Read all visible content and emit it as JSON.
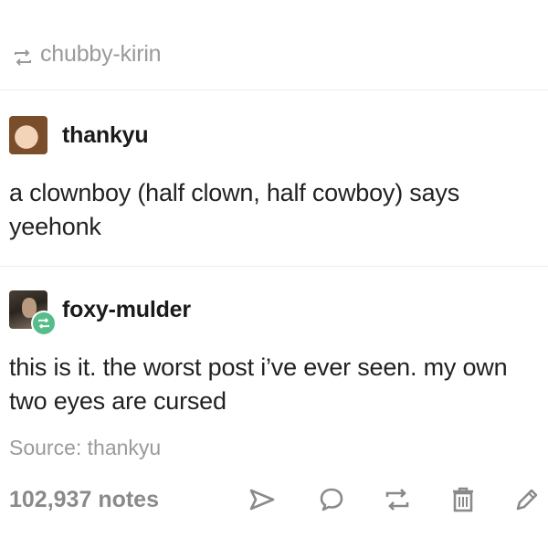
{
  "reblog_header": {
    "icon": "reblog-icon",
    "username": "chubby-kirin"
  },
  "posts": [
    {
      "avatar": "avatar-image",
      "username": "thankyu",
      "text": "a clownboy (half clown, half cowboy) says yeehonk"
    },
    {
      "avatar": "avatar-image",
      "badge_icon": "reblog-icon",
      "username": "foxy-mulder",
      "text": "this is it. the worst post i’ve ever seen. my own two eyes are cursed"
    }
  ],
  "source": "Source: thankyu",
  "footer": {
    "notes": "102,937 notes",
    "actions": [
      "share-icon",
      "reply-icon",
      "reblog-icon",
      "delete-icon",
      "edit-icon"
    ]
  },
  "colors": {
    "muted": "#9a9a9a",
    "text": "#222222",
    "icon": "#8a8a8a",
    "badge": "#56bc8a"
  }
}
